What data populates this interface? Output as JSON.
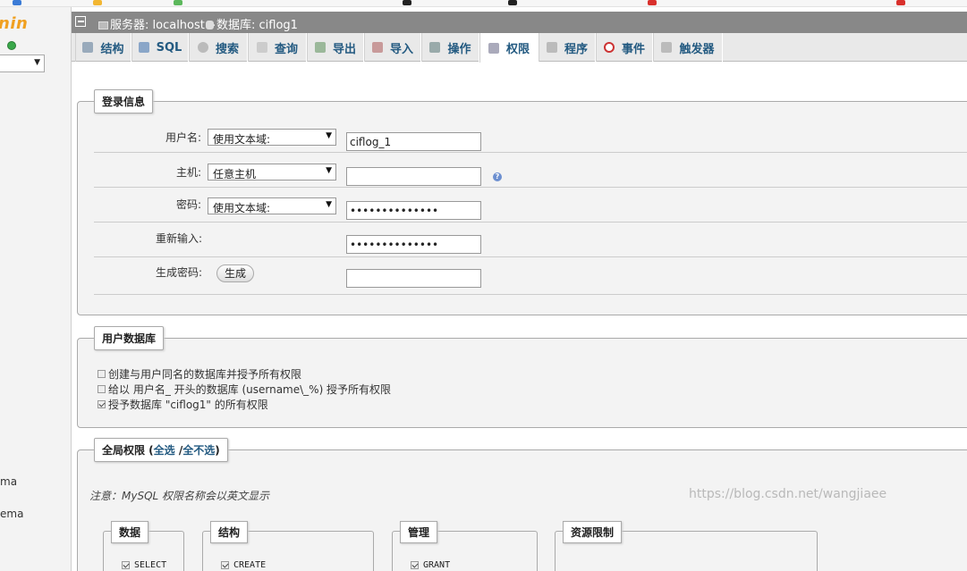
{
  "sidebar": {
    "logo_text": "nin",
    "items": [
      "ma",
      "ema"
    ]
  },
  "header": {
    "server_label": "服务器: localhost »",
    "db_label": "数据库: ciflog1"
  },
  "tabs": [
    {
      "label": "结构",
      "icon": "structure-icon"
    },
    {
      "label": "SQL",
      "icon": "sql-icon"
    },
    {
      "label": "搜索",
      "icon": "search-icon"
    },
    {
      "label": "查询",
      "icon": "query-icon"
    },
    {
      "label": "导出",
      "icon": "export-icon"
    },
    {
      "label": "导入",
      "icon": "import-icon"
    },
    {
      "label": "操作",
      "icon": "wrench-icon"
    },
    {
      "label": "权限",
      "icon": "privileges-icon"
    },
    {
      "label": "程序",
      "icon": "routines-icon"
    },
    {
      "label": "事件",
      "icon": "clock-icon"
    },
    {
      "label": "触发器",
      "icon": "trigger-icon"
    }
  ],
  "login": {
    "legend": "登录信息",
    "username_label": "用户名:",
    "username_mode": "使用文本域:",
    "username_value": "ciflog_1",
    "host_label": "主机:",
    "host_mode": "任意主机",
    "host_value": "",
    "password_label": "密码:",
    "password_mode": "使用文本域:",
    "password_value": "••••••••••••••",
    "retype_label": "重新输入:",
    "retype_value": "••••••••••••••",
    "generate_label": "生成密码:",
    "generate_button": "生成"
  },
  "userdb": {
    "legend": "用户数据库",
    "options": [
      {
        "label": "创建与用户同名的数据库并授予所有权限",
        "checked": false
      },
      {
        "label": "给以 用户名_ 开头的数据库 (username\\_%) 授予所有权限",
        "checked": false
      },
      {
        "label": "授予数据库 \"ciflog1\" 的所有权限",
        "checked": true
      }
    ]
  },
  "global": {
    "legend_prefix": "全局权限 (",
    "select_all": "全选",
    "separator": " /",
    "select_none": "全不选",
    "legend_suffix": ")",
    "note": "注意：MySQL 权限名称会以英文显示"
  },
  "priv_groups": [
    {
      "title": "数据",
      "first": "SELECT"
    },
    {
      "title": "结构",
      "first": "CREATE"
    },
    {
      "title": "管理",
      "first": "GRANT"
    },
    {
      "title": "资源限制",
      "first": ""
    }
  ],
  "watermark": "https://blog.csdn.net/wangjiaee"
}
